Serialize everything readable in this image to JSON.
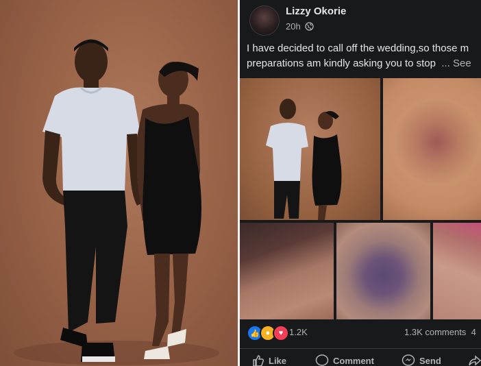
{
  "post": {
    "author": "Lizzy Okorie",
    "time": "20h",
    "privacy_icon": "globe-icon",
    "text_line1": "I have decided to call off the wedding,so those m",
    "text_line2": "preparations am kindly asking you to stop",
    "see_more": "... See"
  },
  "reactions": {
    "icons": [
      "like-icon",
      "wow-icon",
      "love-icon"
    ],
    "count": "1.2K",
    "comments": "1.3K comments",
    "shares_partial": "4"
  },
  "actions": {
    "like": "Like",
    "comment": "Comment",
    "send": "Send"
  },
  "colors": {
    "fb_bg": "#18191a",
    "text_primary": "#e4e6eb",
    "text_secondary": "#b0b3b8",
    "like_blue": "#1877f2",
    "love_red": "#f33e58",
    "wow_yellow": "#f7b125"
  }
}
